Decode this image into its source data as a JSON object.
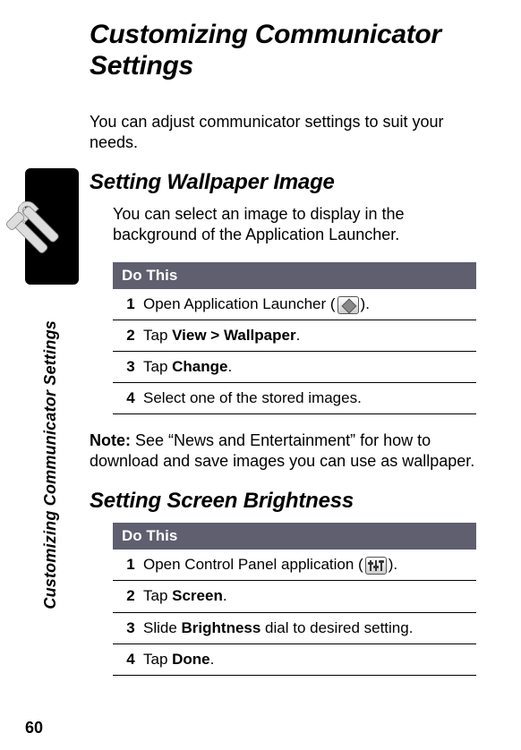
{
  "page_number": "60",
  "sidebar_label": "Customizing Communicator Settings",
  "title": "Customizing Communicator Settings",
  "intro_text": "You can adjust communicator settings to suit your needs.",
  "section1": {
    "heading": "Setting Wallpaper Image",
    "intro": "You can select an image to display in the background of the Application Launcher.",
    "table_header": "Do This",
    "steps": [
      {
        "n": "1",
        "pre": "Open Application Launcher (",
        "icon": "launcher-icon",
        "post": ")."
      },
      {
        "n": "2",
        "pre": "Tap ",
        "bold": "View > Wallpaper",
        "post": "."
      },
      {
        "n": "3",
        "pre": "Tap ",
        "bold": "Change",
        "post": "."
      },
      {
        "n": "4",
        "pre": "Select one of the stored images."
      }
    ],
    "note_label": "Note:",
    "note_text": " See “News and Entertainment” for how to download and save images you can use as wallpaper."
  },
  "section2": {
    "heading": "Setting Screen Brightness",
    "table_header": "Do This",
    "steps": [
      {
        "n": "1",
        "pre": "Open Control Panel application (",
        "icon": "control-icon",
        "post": ")."
      },
      {
        "n": "2",
        "pre": "Tap ",
        "bold": "Screen",
        "post": "."
      },
      {
        "n": "3",
        "pre": "Slide ",
        "bold": "Brightness",
        "post": " dial to desired setting."
      },
      {
        "n": "4",
        "pre": "Tap ",
        "bold": "Done",
        "post": "."
      }
    ]
  }
}
